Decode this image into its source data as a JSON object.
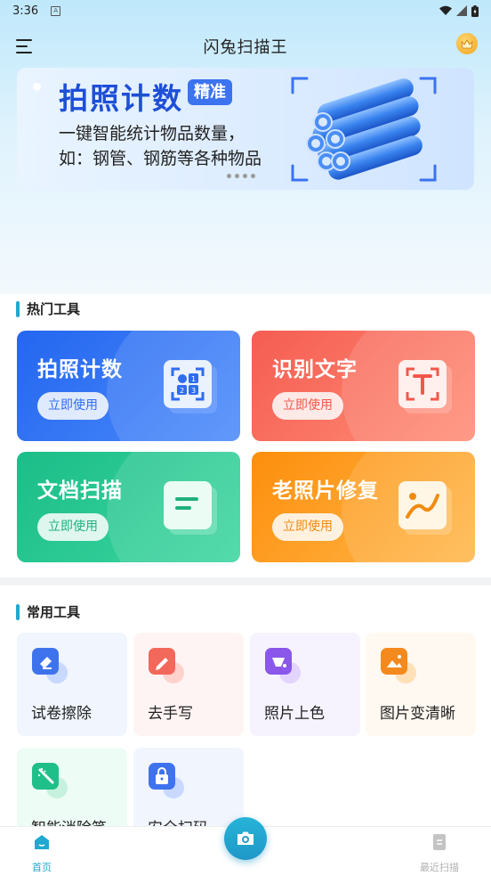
{
  "status_bar": {
    "time": "3:36",
    "notification_letter": "A"
  },
  "header": {
    "title": "闪兔扫描王",
    "menu_icon": "menu-icon",
    "vip_icon": "crown-icon"
  },
  "banner": {
    "title": "拍照计数",
    "tag": "精准",
    "desc_line1": "一键智能统计物品数量，",
    "desc_line2": "如：钢管、钢筋等各种物品",
    "pages": 4,
    "active_page": 1
  },
  "hot_tools": {
    "title": "热门工具",
    "cards": [
      {
        "title": "拍照计数",
        "button": "立即使用",
        "icon": "count-icon",
        "color": "#2f6cf0",
        "button_color": "#2f6cf0"
      },
      {
        "title": "识别文字",
        "button": "立即使用",
        "icon": "text-recognition-icon",
        "color": "#f66b5c",
        "button_color": "#f3574a"
      },
      {
        "title": "文档扫描",
        "button": "立即使用",
        "icon": "document-icon",
        "color": "#26c48f",
        "button_color": "#1fb07e"
      },
      {
        "title": "老照片修复",
        "button": "立即使用",
        "icon": "photo-repair-icon",
        "color": "#fd9a21",
        "button_color": "#f08b0f"
      }
    ]
  },
  "common_tools": {
    "title": "常用工具",
    "items": [
      {
        "label": "试卷擦除",
        "icon": "eraser-icon",
        "bg": "#f1f5fe"
      },
      {
        "label": "去手写",
        "icon": "pen-icon",
        "bg": "#fff4f4"
      },
      {
        "label": "照片上色",
        "icon": "paint-bucket-icon",
        "bg": "#f6f3fe"
      },
      {
        "label": "图片变清晰",
        "icon": "image-clarity-icon",
        "bg": "#fff9f1"
      },
      {
        "label": "智能消除笔",
        "icon": "magic-wand-icon",
        "bg": "#eefcf6"
      },
      {
        "label": "安全扫码",
        "icon": "lock-icon",
        "bg": "#f1f5fe"
      }
    ]
  },
  "bottom_nav": {
    "home_label": "首页",
    "recent_label": "最近扫描",
    "camera_icon": "camera-icon",
    "active_color": "#1fa9d0"
  }
}
